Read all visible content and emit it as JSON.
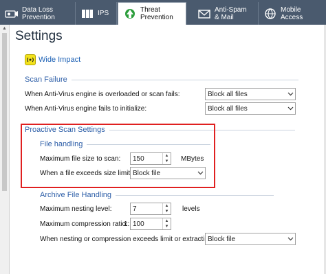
{
  "tabs": [
    {
      "name": "tab-data-loss-prevention",
      "line1": "Data Loss",
      "line2": "Prevention",
      "icon": "data-loss-icon",
      "active": false
    },
    {
      "name": "tab-ips",
      "line1": "IPS",
      "line2": "",
      "icon": "ips-icon",
      "active": false
    },
    {
      "name": "tab-threat-prevention",
      "line1": "Threat",
      "line2": "Prevention",
      "icon": "threat-prevention-icon",
      "active": true
    },
    {
      "name": "tab-anti-spam",
      "line1": "Anti-Spam",
      "line2": "& Mail",
      "icon": "mail-icon",
      "active": false
    },
    {
      "name": "tab-mobile-access",
      "line1": "Mobile",
      "line2": "Access",
      "icon": "mobile-access-icon",
      "active": false
    }
  ],
  "page": {
    "title": "Settings",
    "wide_impact": "Wide Impact"
  },
  "scan_failure": {
    "header": "Scan Failure",
    "overloaded_label": "When Anti-Virus engine is overloaded or scan fails:",
    "overloaded_value": "Block all files",
    "init_label": "When Anti-Virus engine fails to initialize:",
    "init_value": "Block all files"
  },
  "proactive": {
    "header": "Proactive Scan Settings",
    "file_handling": {
      "header": "File handling",
      "max_size_label": "Maximum file size to scan:",
      "max_size_value": "150",
      "max_size_unit": "MBytes",
      "exceeds_label": "When a file exceeds size limit:",
      "exceeds_value": "Block file"
    },
    "archive": {
      "header": "Archive File Handling",
      "nesting_label": "Maximum nesting level:",
      "nesting_value": "7",
      "nesting_unit": "levels",
      "ratio_label": "Maximum compression ratio:",
      "ratio_prefix": "1:",
      "ratio_value": "100",
      "exceeds_label": "When nesting or compression exceeds limit or extraction fails:",
      "exceeds_value": "Block file"
    }
  },
  "colors": {
    "tabbar": "#4a5a6e",
    "section_header": "#2e5fa8",
    "highlight_box": "#e02020"
  }
}
